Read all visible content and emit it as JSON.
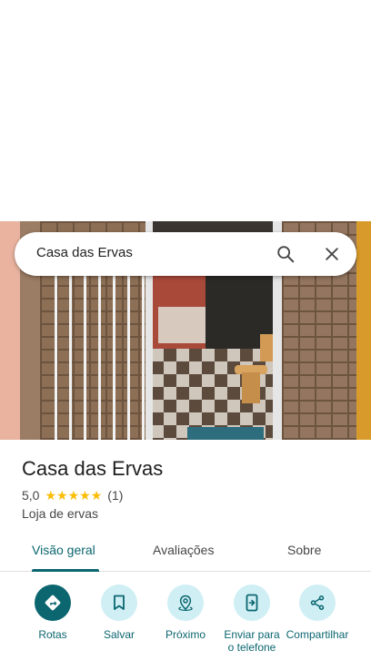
{
  "search": {
    "query": "Casa das Ervas",
    "search_icon": "search-icon",
    "clear_icon": "close-icon"
  },
  "place": {
    "name": "Casa das Ervas",
    "rating": "5,0",
    "stars": 5,
    "review_count": "(1)",
    "category": "Loja de ervas"
  },
  "tabs": [
    {
      "label": "Visão geral",
      "active": true
    },
    {
      "label": "Avaliações",
      "active": false
    },
    {
      "label": "Sobre",
      "active": false
    }
  ],
  "actions": [
    {
      "label": "Rotas",
      "icon": "directions-icon"
    },
    {
      "label": "Salvar",
      "icon": "bookmark-icon"
    },
    {
      "label": "Próximo",
      "icon": "nearby-icon"
    },
    {
      "label": "Enviar para o telefone",
      "icon": "send-to-phone-icon"
    },
    {
      "label": "Compartilhar",
      "icon": "share-icon"
    }
  ],
  "colors": {
    "accent": "#0b6670",
    "accent_light": "#cfeff4",
    "star": "#fbbc04",
    "text": "#1f1f1f",
    "secondary_text": "#474747"
  }
}
